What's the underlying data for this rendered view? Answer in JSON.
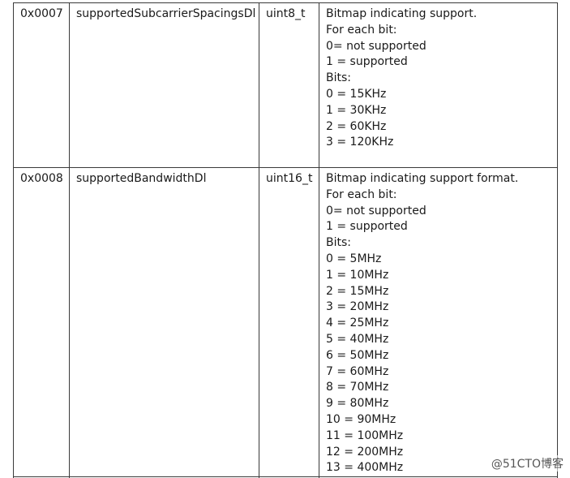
{
  "rows": [
    {
      "id": "0x0007",
      "name": "supportedSubcarrierSpacingsDl",
      "type": "uint8_t",
      "description": [
        "Bitmap indicating support.",
        "For each bit:",
        "0= not supported",
        "1 = supported",
        "Bits:",
        "0 = 15KHz",
        "1 = 30KHz",
        "2 = 60KHz",
        "3 = 120KHz"
      ]
    },
    {
      "id": "0x0008",
      "name": "supportedBandwidthDl",
      "type": "uint16_t",
      "description": [
        "Bitmap indicating support format.",
        "For each bit:",
        "0= not supported",
        "1 = supported",
        "Bits:",
        "0 = 5MHz",
        "1 = 10MHz",
        "2 = 15MHz",
        "3 = 20MHz",
        "4 = 25MHz",
        "5 = 40MHz",
        "6 = 50MHz",
        "7 = 60MHz",
        "8 = 70MHz",
        "9 = 80MHz",
        "10 = 90MHz",
        "11 = 100MHz",
        "12 = 200MHz",
        "13 = 400MHz"
      ]
    }
  ],
  "watermark": "@51CTO博客"
}
